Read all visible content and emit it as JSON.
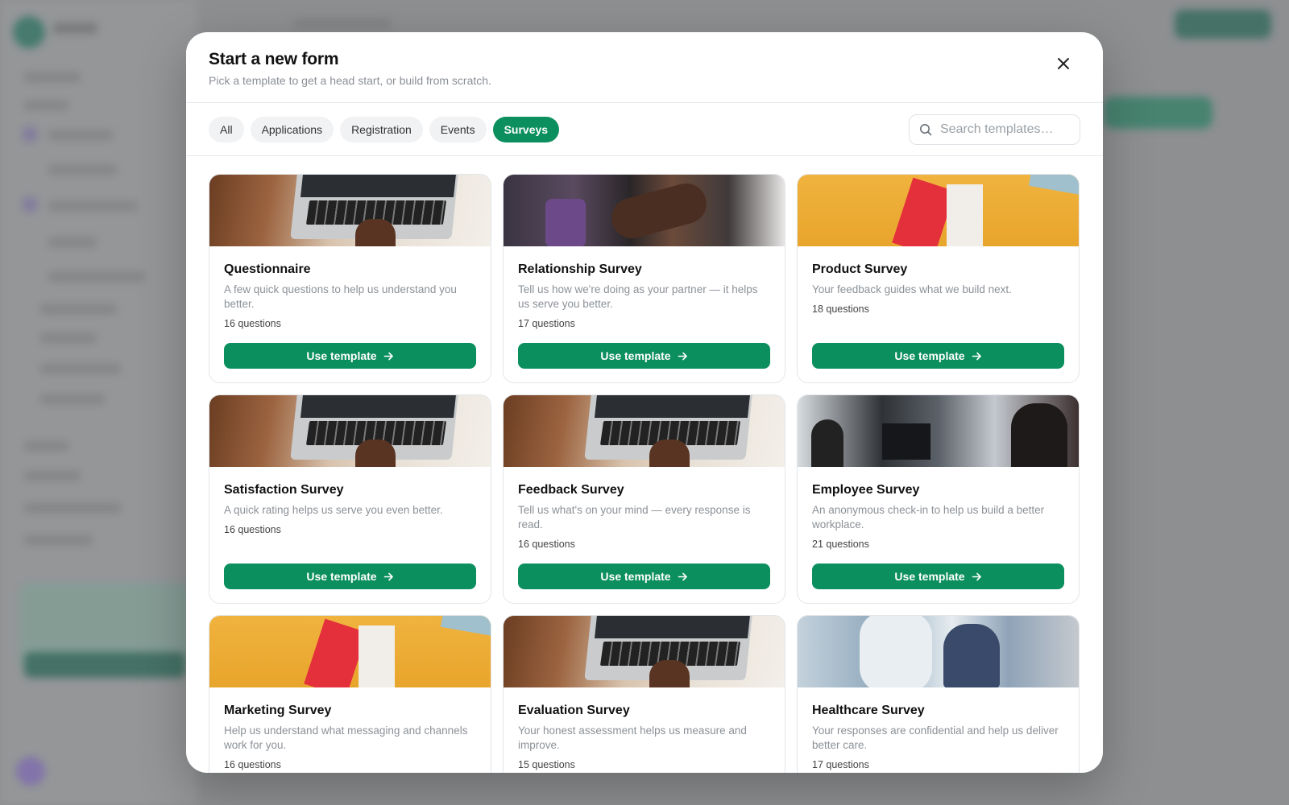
{
  "modal": {
    "title": "Start a new form",
    "subtitle": "Pick a template to get a head start, or build from scratch."
  },
  "filters": [
    {
      "label": "All",
      "active": false
    },
    {
      "label": "Applications",
      "active": false
    },
    {
      "label": "Registration",
      "active": false
    },
    {
      "label": "Events",
      "active": false
    },
    {
      "label": "Surveys",
      "active": true
    }
  ],
  "search": {
    "placeholder": "Search templates…",
    "value": ""
  },
  "use_button_label": "Use template",
  "templates": [
    {
      "title": "Questionnaire",
      "description": "A few quick questions to help us understand you better.",
      "count": "16 questions",
      "image": "laptop"
    },
    {
      "title": "Relationship Survey",
      "description": "Tell us how we're doing as your partner — it helps us serve you better.",
      "count": "17 questions",
      "image": "handshake"
    },
    {
      "title": "Product Survey",
      "description": "Your feedback guides what we build next.",
      "count": "18 questions",
      "image": "shopping-bags"
    },
    {
      "title": "Satisfaction Survey",
      "description": "A quick rating helps us serve you even better.",
      "count": "16 questions",
      "image": "laptop"
    },
    {
      "title": "Feedback Survey",
      "description": "Tell us what's on your mind — every response is read.",
      "count": "16 questions",
      "image": "laptop"
    },
    {
      "title": "Employee Survey",
      "description": "An anonymous check-in to help us build a better workplace.",
      "count": "21 questions",
      "image": "office"
    },
    {
      "title": "Marketing Survey",
      "description": "Help us understand what messaging and channels work for you.",
      "count": "16 questions",
      "image": "shopping-bags"
    },
    {
      "title": "Evaluation Survey",
      "description": "Your honest assessment helps us measure and improve.",
      "count": "15 questions",
      "image": "laptop"
    },
    {
      "title": "Healthcare Survey",
      "description": "Your responses are confidential and help us deliver better care.",
      "count": "17 questions",
      "image": "healthcare"
    }
  ],
  "colors": {
    "accent": "#0c8f5f",
    "chip_bg": "#f1f2f4"
  }
}
